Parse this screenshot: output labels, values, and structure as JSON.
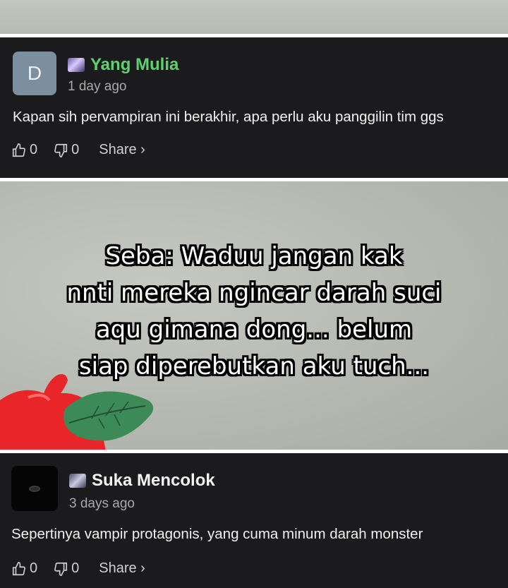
{
  "comments": [
    {
      "avatar_letter": "D",
      "username": "Yang Mulia",
      "time": "1 day ago",
      "text": "Kapan sih pervampiran ini berakhir, apa perlu aku panggilin tim ggs",
      "likes": "0",
      "dislikes": "0",
      "share_label": "Share ›"
    },
    {
      "username": "Suka Mencolok",
      "time": "3 days ago",
      "text": "Sepertinya vampir protagonis, yang cuma minum darah monster",
      "likes": "0",
      "dislikes": "0",
      "share_label": "Share ›"
    }
  ],
  "panel_caption": {
    "lines": [
      "Seba: Waduu jangan kak",
      "nnti mereka ngincar darah suci",
      "aqu gimana dong... belum",
      "siap diperebutkan aku tuch..."
    ]
  },
  "colors": {
    "username_green": "#5fd072",
    "background": "#1b1b1d"
  }
}
